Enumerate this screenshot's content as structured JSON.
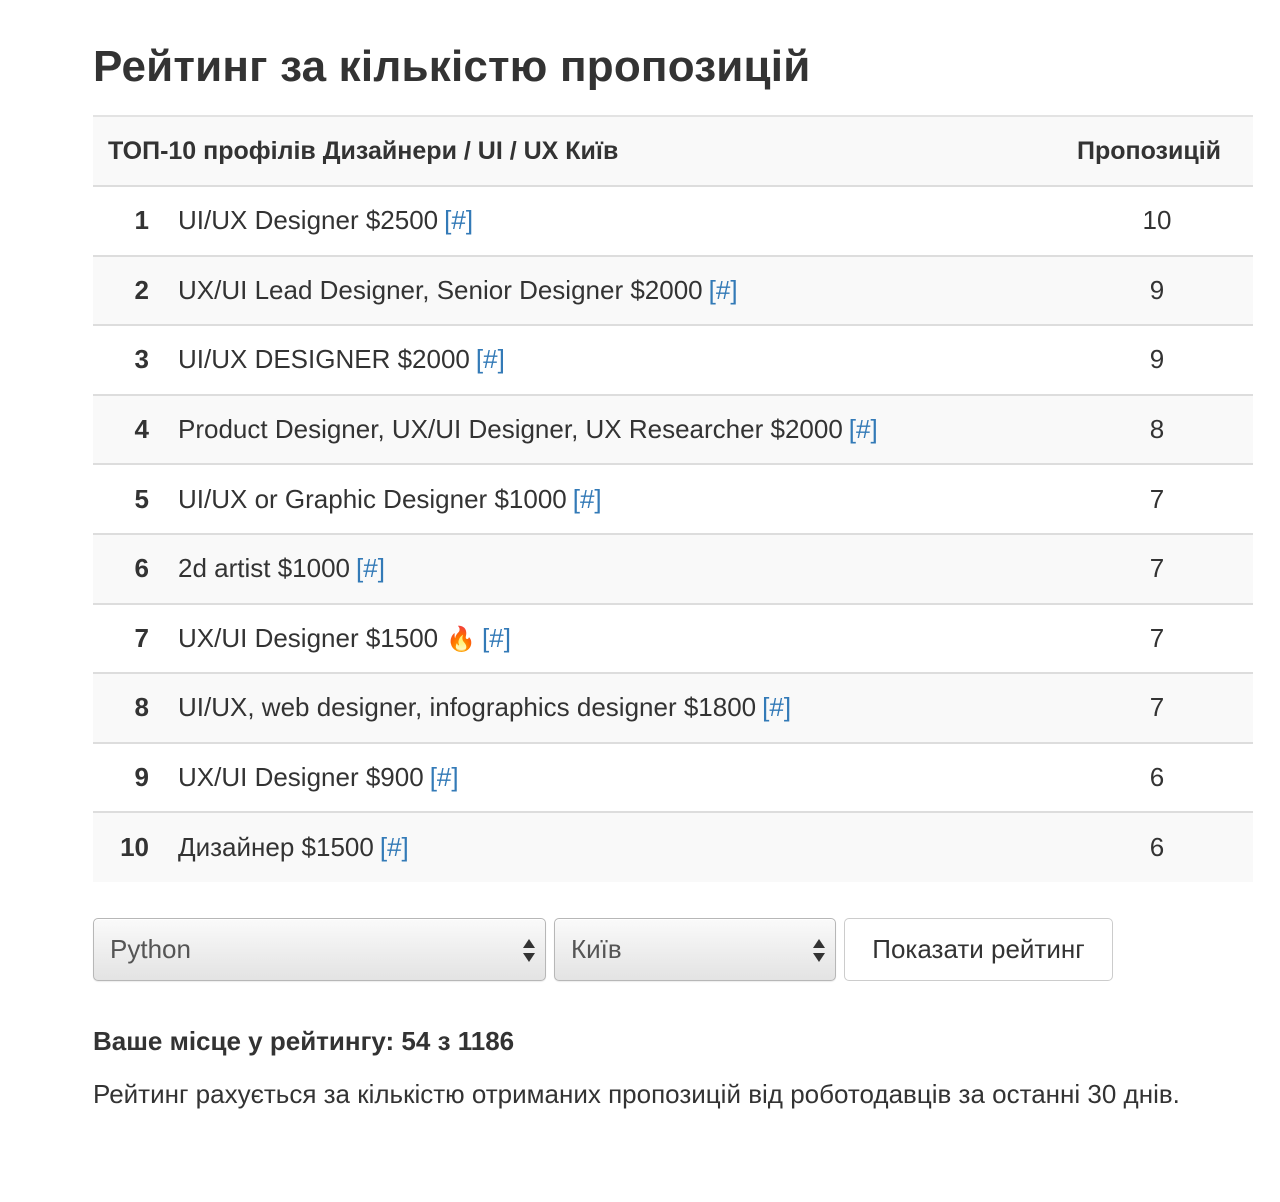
{
  "page": {
    "title": "Рейтинг за кількістю пропозицій"
  },
  "table": {
    "headers": {
      "profile": "ТОП-10 профілів Дизайнери / UI / UX Київ",
      "count": "Пропозицій"
    },
    "rows": [
      {
        "rank": "1",
        "profile": "UI/UX Designer $2500",
        "fire": "",
        "link": "[#]",
        "count": "10"
      },
      {
        "rank": "2",
        "profile": "UX/UI Lead Designer, Senior Designer $2000",
        "fire": "",
        "link": "[#]",
        "count": "9"
      },
      {
        "rank": "3",
        "profile": "UI/UX DESIGNER $2000",
        "fire": "",
        "link": "[#]",
        "count": "9"
      },
      {
        "rank": "4",
        "profile": "Product Designer, UX/UI Designer, UX Researcher $2000",
        "fire": "",
        "link": "[#]",
        "count": "8"
      },
      {
        "rank": "5",
        "profile": "UI/UX or Graphic Designer $1000",
        "fire": "",
        "link": "[#]",
        "count": "7"
      },
      {
        "rank": "6",
        "profile": "2d artist $1000",
        "fire": "",
        "link": "[#]",
        "count": "7"
      },
      {
        "rank": "7",
        "profile": "UX/UI Designer $1500",
        "fire": "🔥",
        "link": "[#]",
        "count": "7"
      },
      {
        "rank": "8",
        "profile": "UI/UX, web designer, infographics designer $1800",
        "fire": "",
        "link": "[#]",
        "count": "7"
      },
      {
        "rank": "9",
        "profile": "UX/UI Designer $900",
        "fire": "",
        "link": "[#]",
        "count": "6"
      },
      {
        "rank": "10",
        "profile": "Дизайнер $1500",
        "fire": "",
        "link": "[#]",
        "count": "6"
      }
    ]
  },
  "controls": {
    "language_select": "Python",
    "city_select": "Київ",
    "show_button": "Показати рейтинг"
  },
  "footer": {
    "my_place": "Ваше місце у рейтингу: 54 з 1186",
    "note": "Рейтинг рахується за кількістю отриманих пропозицій від роботодавців за останні 30 днів."
  },
  "colors": {
    "link": "#337ab7",
    "text": "#333333",
    "stripe": "#f9f9f9",
    "border": "#dddddd"
  },
  "icons": {
    "fire": "fire-icon",
    "select_arrows": "select-arrows-icon"
  }
}
